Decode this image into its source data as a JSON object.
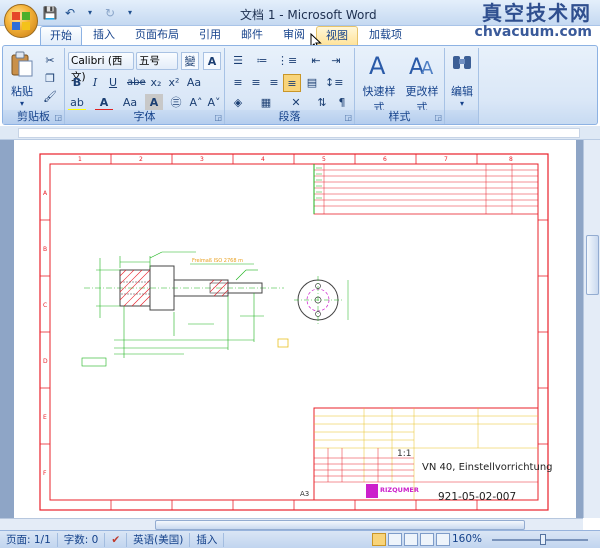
{
  "window": {
    "title": "文档 1 - Microsoft Word",
    "watermark_cn": "真空技术网",
    "watermark_url": "chvacuum.com"
  },
  "tabs": [
    {
      "label": "开始",
      "active": true
    },
    {
      "label": "插入"
    },
    {
      "label": "页面布局"
    },
    {
      "label": "引用"
    },
    {
      "label": "邮件"
    },
    {
      "label": "审阅"
    },
    {
      "label": "视图"
    },
    {
      "label": "加载项"
    }
  ],
  "ribbon": {
    "clipboard": {
      "label": "剪贴板",
      "paste": "粘贴"
    },
    "font": {
      "label": "字体",
      "font_name": "Calibri (西文)",
      "font_size": "五号"
    },
    "paragraph": {
      "label": "段落"
    },
    "styles": {
      "label": "样式",
      "quick_styles": "快速样式",
      "change_styles": "更改样式"
    },
    "editing": {
      "label": "编辑",
      "edit": "编辑"
    }
  },
  "drawing": {
    "sheet_size": "A3",
    "scale": "1:1",
    "part_title": "VN 40, Einstellvorrichtung",
    "drawing_number": "921-05-02-007",
    "company": "RIZQUMER",
    "tolerance_note": "Freimaß ISO 2768 m",
    "zone_numbers": [
      "1",
      "2",
      "3",
      "4",
      "5",
      "6",
      "7",
      "8"
    ],
    "zone_letters": [
      "A",
      "B",
      "C",
      "D",
      "E",
      "F"
    ]
  },
  "status": {
    "page": "页面: 1/1",
    "words": "字数: 0",
    "language": "英语(美国)",
    "mode": "插入",
    "zoom": "160%"
  }
}
